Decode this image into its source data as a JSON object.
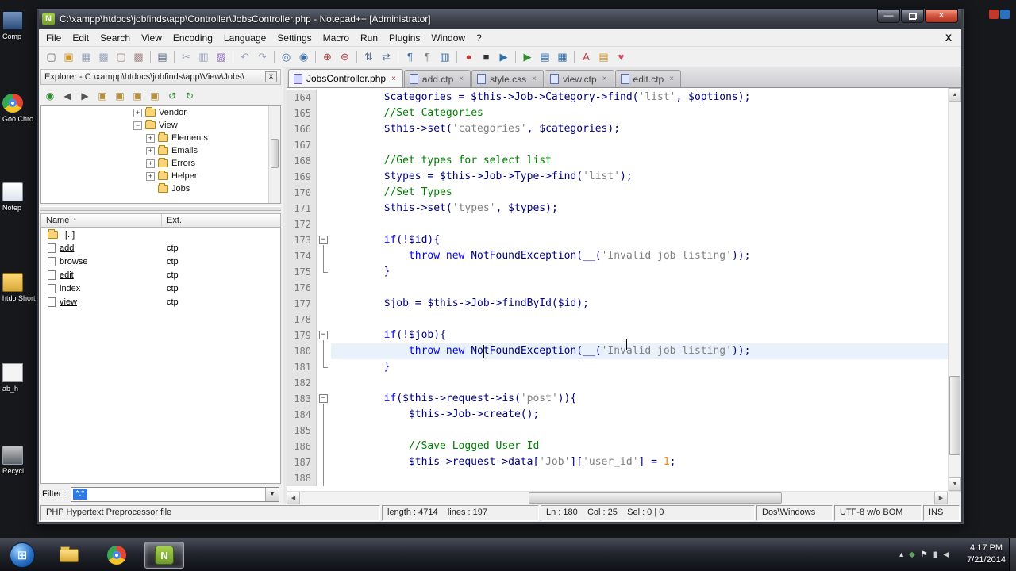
{
  "icons": {
    "npp_logo": "N",
    "window_minimize": "—",
    "window_close": "×",
    "menu_close": "X",
    "panel_close": "x",
    "tab_close": "×",
    "dropdown_arrow": "▼",
    "scroll_up": "▲",
    "scroll_down": "▼",
    "scroll_left": "◀",
    "scroll_right": "▶",
    "start_orb": "⊞",
    "sort_up": "^"
  },
  "desktop": {
    "left_icons": [
      {
        "name": "computer",
        "label": "Comp"
      },
      {
        "name": "google-chrome",
        "label": "Goo Chro"
      },
      {
        "name": "notepad",
        "label": "Notep"
      },
      {
        "name": "htdocs-shortcut",
        "label": "htdo Short"
      },
      {
        "name": "ab_h",
        "label": "ab_h"
      },
      {
        "name": "recycle-bin",
        "label": "Recycl"
      }
    ]
  },
  "window": {
    "title": "C:\\xampp\\htdocs\\jobfinds\\app\\Controller\\JobsController.php - Notepad++ [Administrator]",
    "menu_items": [
      "File",
      "Edit",
      "Search",
      "View",
      "Encoding",
      "Language",
      "Settings",
      "Macro",
      "Run",
      "Plugins",
      "Window",
      "?"
    ]
  },
  "toolbar_icons": [
    {
      "name": "new-file-icon",
      "g": "▢",
      "c": "#6b6b6b"
    },
    {
      "name": "open-file-icon",
      "g": "▣",
      "c": "#c9942a"
    },
    {
      "name": "save-icon",
      "g": "▦",
      "c": "#9aa2b8"
    },
    {
      "name": "save-all-icon",
      "g": "▩",
      "c": "#9aa2b8"
    },
    {
      "name": "close-file-icon",
      "g": "▢",
      "c": "#a08585"
    },
    {
      "name": "close-all-icon",
      "g": "▩",
      "c": "#a08585"
    },
    {
      "sep": true
    },
    {
      "name": "print-icon",
      "g": "▤",
      "c": "#5a6b8c"
    },
    {
      "sep": true
    },
    {
      "name": "cut-icon",
      "g": "✂",
      "c": "#9aa2b8"
    },
    {
      "name": "copy-icon",
      "g": "▥",
      "c": "#9aa2b8"
    },
    {
      "name": "paste-icon",
      "g": "▨",
      "c": "#8a6bb8"
    },
    {
      "sep": true
    },
    {
      "name": "undo-icon",
      "g": "↶",
      "c": "#9aa2b8"
    },
    {
      "name": "redo-icon",
      "g": "↷",
      "c": "#9aa2b8"
    },
    {
      "sep": true
    },
    {
      "name": "find-icon",
      "g": "◎",
      "c": "#3a6ea5"
    },
    {
      "name": "replace-icon",
      "g": "◉",
      "c": "#3a6ea5"
    },
    {
      "sep": true
    },
    {
      "name": "zoom-in-icon",
      "g": "⊕",
      "c": "#b43b3b"
    },
    {
      "name": "zoom-out-icon",
      "g": "⊖",
      "c": "#b43b3b"
    },
    {
      "sep": true
    },
    {
      "name": "sync-vertical-icon",
      "g": "⇅",
      "c": "#5a6b8c"
    },
    {
      "name": "sync-horizontal-icon",
      "g": "⇄",
      "c": "#5a6b8c"
    },
    {
      "sep": true
    },
    {
      "name": "word-wrap-icon",
      "g": "¶",
      "c": "#3a6ea5"
    },
    {
      "name": "show-all-chars-icon",
      "g": "¶",
      "c": "#7c7c7c"
    },
    {
      "name": "indent-guide-icon",
      "g": "▥",
      "c": "#3a6ea5"
    },
    {
      "sep": true
    },
    {
      "name": "macro-record-icon",
      "g": "●",
      "c": "#c23b3b"
    },
    {
      "name": "macro-stop-icon",
      "g": "■",
      "c": "#333333"
    },
    {
      "name": "macro-play-icon",
      "g": "▶",
      "c": "#2e6fb0"
    },
    {
      "sep": true
    },
    {
      "name": "run-icon",
      "g": "▶",
      "c": "#2e8b2e"
    },
    {
      "name": "function-list-icon",
      "g": "▤",
      "c": "#2e6fb0"
    },
    {
      "name": "doc-map-icon",
      "g": "▦",
      "c": "#2e6fb0"
    },
    {
      "sep": true
    },
    {
      "name": "spell-check-icon",
      "g": "A",
      "c": "#c23b3b"
    },
    {
      "name": "doc-switcher-icon",
      "g": "▤",
      "c": "#d1962e"
    },
    {
      "name": "plugin-heart-icon",
      "g": "♥",
      "c": "#d14b6b"
    }
  ],
  "explorer": {
    "title": "Explorer - C:\\xampp\\htdocs\\jobfinds\\app\\View\\Jobs\\",
    "toolbar_icons": [
      {
        "name": "explorer-info-icon",
        "g": "◉",
        "c": "#2e8b2e"
      },
      {
        "name": "explorer-back-icon",
        "g": "◀",
        "c": "#555555"
      },
      {
        "name": "explorer-forward-icon",
        "g": "▶",
        "c": "#555555"
      },
      {
        "name": "explorer-folder-up-icon",
        "g": "▣",
        "c": "#b8913a"
      },
      {
        "name": "explorer-folder-sync-icon",
        "g": "▣",
        "c": "#b8913a"
      },
      {
        "name": "explorer-folder-find-icon",
        "g": "▣",
        "c": "#b8913a"
      },
      {
        "name": "explorer-folder-fav-icon",
        "g": "▣",
        "c": "#b8913a"
      },
      {
        "name": "explorer-refresh-icon",
        "g": "↺",
        "c": "#2e8b2e"
      },
      {
        "name": "explorer-refresh-all-icon",
        "g": "↻",
        "c": "#2e8b2e"
      }
    ],
    "tree_items": [
      {
        "label": "Vendor",
        "level": 1,
        "toggle": "plus"
      },
      {
        "label": "View",
        "level": 1,
        "toggle": "minus"
      },
      {
        "label": "Elements",
        "level": 2,
        "toggle": "plus"
      },
      {
        "label": "Emails",
        "level": 2,
        "toggle": "plus"
      },
      {
        "label": "Errors",
        "level": 2,
        "toggle": "plus"
      },
      {
        "label": "Helper",
        "level": 2,
        "toggle": "plus"
      },
      {
        "label": "Jobs",
        "level": 2,
        "toggle": "none"
      }
    ],
    "list_headers": [
      "Name",
      "Ext."
    ],
    "files": [
      {
        "name": "[..]",
        "ext": "",
        "icon": "folder-up",
        "link": false
      },
      {
        "name": "add",
        "ext": "ctp",
        "icon": "file",
        "link": true
      },
      {
        "name": "browse",
        "ext": "ctp",
        "icon": "file",
        "link": false
      },
      {
        "name": "edit",
        "ext": "ctp",
        "icon": "file",
        "link": true
      },
      {
        "name": "index",
        "ext": "ctp",
        "icon": "file",
        "link": false
      },
      {
        "name": "view",
        "ext": "ctp",
        "icon": "file",
        "link": true
      }
    ],
    "filter_label": "Filter :",
    "filter_value": "*.*"
  },
  "tabs": [
    {
      "label": "JobsController.php",
      "active": true
    },
    {
      "label": "add.ctp",
      "active": false
    },
    {
      "label": "style.css",
      "active": false
    },
    {
      "label": "view.ctp",
      "active": false
    },
    {
      "label": "edit.ctp",
      "active": false
    }
  ],
  "editor": {
    "current_line": 180,
    "caret_col": 25,
    "lines": [
      {
        "n": 164,
        "f": "",
        "s": [
          [
            "pl",
            "        $categories = $this->Job->Category->find("
          ],
          [
            "st",
            "'list'"
          ],
          [
            "pl",
            ", $options);"
          ]
        ]
      },
      {
        "n": 165,
        "f": "",
        "s": [
          [
            "pl",
            "        "
          ],
          [
            "cm",
            "//Set Categories"
          ]
        ]
      },
      {
        "n": 166,
        "f": "",
        "s": [
          [
            "pl",
            "        $this->set("
          ],
          [
            "st",
            "'categories'"
          ],
          [
            "pl",
            ", $categories);"
          ]
        ]
      },
      {
        "n": 167,
        "f": "",
        "s": []
      },
      {
        "n": 168,
        "f": "",
        "s": [
          [
            "pl",
            "        "
          ],
          [
            "cm",
            "//Get types for select list"
          ]
        ]
      },
      {
        "n": 169,
        "f": "",
        "s": [
          [
            "pl",
            "        $types = $this->Job->Type->find("
          ],
          [
            "st",
            "'list'"
          ],
          [
            "pl",
            ");"
          ]
        ]
      },
      {
        "n": 170,
        "f": "",
        "s": [
          [
            "pl",
            "        "
          ],
          [
            "cm",
            "//Set Types"
          ]
        ]
      },
      {
        "n": 171,
        "f": "",
        "s": [
          [
            "pl",
            "        $this->set("
          ],
          [
            "st",
            "'types'"
          ],
          [
            "pl",
            ", $types);"
          ]
        ]
      },
      {
        "n": 172,
        "f": "",
        "s": []
      },
      {
        "n": 173,
        "f": "m",
        "s": [
          [
            "pl",
            "        "
          ],
          [
            "kw",
            "if"
          ],
          [
            "pl",
            "(!$id){"
          ]
        ]
      },
      {
        "n": 174,
        "f": "v",
        "s": [
          [
            "pl",
            "            "
          ],
          [
            "kw",
            "throw"
          ],
          [
            "pl",
            " "
          ],
          [
            "kw",
            "new"
          ],
          [
            "pl",
            " NotFoundException(__("
          ],
          [
            "st",
            "'Invalid job listing'"
          ],
          [
            "pl",
            "));"
          ]
        ]
      },
      {
        "n": 175,
        "f": "e",
        "s": [
          [
            "pl",
            "        }"
          ]
        ]
      },
      {
        "n": 176,
        "f": "",
        "s": []
      },
      {
        "n": 177,
        "f": "",
        "s": [
          [
            "pl",
            "        $job = $this->Job->findById($id);"
          ]
        ]
      },
      {
        "n": 178,
        "f": "",
        "s": []
      },
      {
        "n": 179,
        "f": "m",
        "s": [
          [
            "pl",
            "        "
          ],
          [
            "kw",
            "if"
          ],
          [
            "pl",
            "(!$job){"
          ]
        ]
      },
      {
        "n": 180,
        "f": "v",
        "s": [
          [
            "pl",
            "            "
          ],
          [
            "kw",
            "throw"
          ],
          [
            "pl",
            " "
          ],
          [
            "kw",
            "new"
          ],
          [
            "pl",
            " NotFoundException(__("
          ],
          [
            "st",
            "'Invalid job listing'"
          ],
          [
            "pl",
            "));"
          ]
        ]
      },
      {
        "n": 181,
        "f": "e",
        "s": [
          [
            "pl",
            "        }"
          ]
        ]
      },
      {
        "n": 182,
        "f": "",
        "s": []
      },
      {
        "n": 183,
        "f": "m",
        "s": [
          [
            "pl",
            "        "
          ],
          [
            "kw",
            "if"
          ],
          [
            "pl",
            "($this->request->is("
          ],
          [
            "st",
            "'post'"
          ],
          [
            "pl",
            ")){"
          ]
        ]
      },
      {
        "n": 184,
        "f": "v",
        "s": [
          [
            "pl",
            "            $this->Job->create();"
          ]
        ]
      },
      {
        "n": 185,
        "f": "v",
        "s": []
      },
      {
        "n": 186,
        "f": "v",
        "s": [
          [
            "pl",
            "            "
          ],
          [
            "cm",
            "//Save Logged User Id"
          ]
        ]
      },
      {
        "n": 187,
        "f": "v",
        "s": [
          [
            "pl",
            "            $this->request->data["
          ],
          [
            "st",
            "'Job'"
          ],
          [
            "pl",
            "]["
          ],
          [
            "st",
            "'user_id'"
          ],
          [
            "pl",
            "] = "
          ],
          [
            "nu",
            "1"
          ],
          [
            "pl",
            ";"
          ]
        ]
      },
      {
        "n": 188,
        "f": "v",
        "s": []
      }
    ]
  },
  "status_bar": {
    "doc_type": "PHP Hypertext Preprocessor file",
    "length_lines": "length : 4714    lines : 197",
    "position": "Ln : 180    Col : 25    Sel : 0 | 0",
    "eol": "Dos\\Windows",
    "encoding": "UTF-8 w/o BOM",
    "mode": "INS"
  },
  "taskbar": {
    "time": "4:17 PM",
    "date": "7/21/2014",
    "tray_icons": [
      {
        "name": "show-hidden-icons-icon",
        "g": "▴",
        "c": "#e8e8e8"
      },
      {
        "name": "tray-app-icon",
        "g": "◆",
        "c": "#58a858"
      },
      {
        "name": "action-center-icon",
        "g": "⚑",
        "c": "#e8e8e8"
      },
      {
        "name": "network-icon",
        "g": "▮",
        "c": "#cfcfcf"
      },
      {
        "name": "volume-icon",
        "g": "◀",
        "c": "#cfcfcf"
      }
    ]
  }
}
